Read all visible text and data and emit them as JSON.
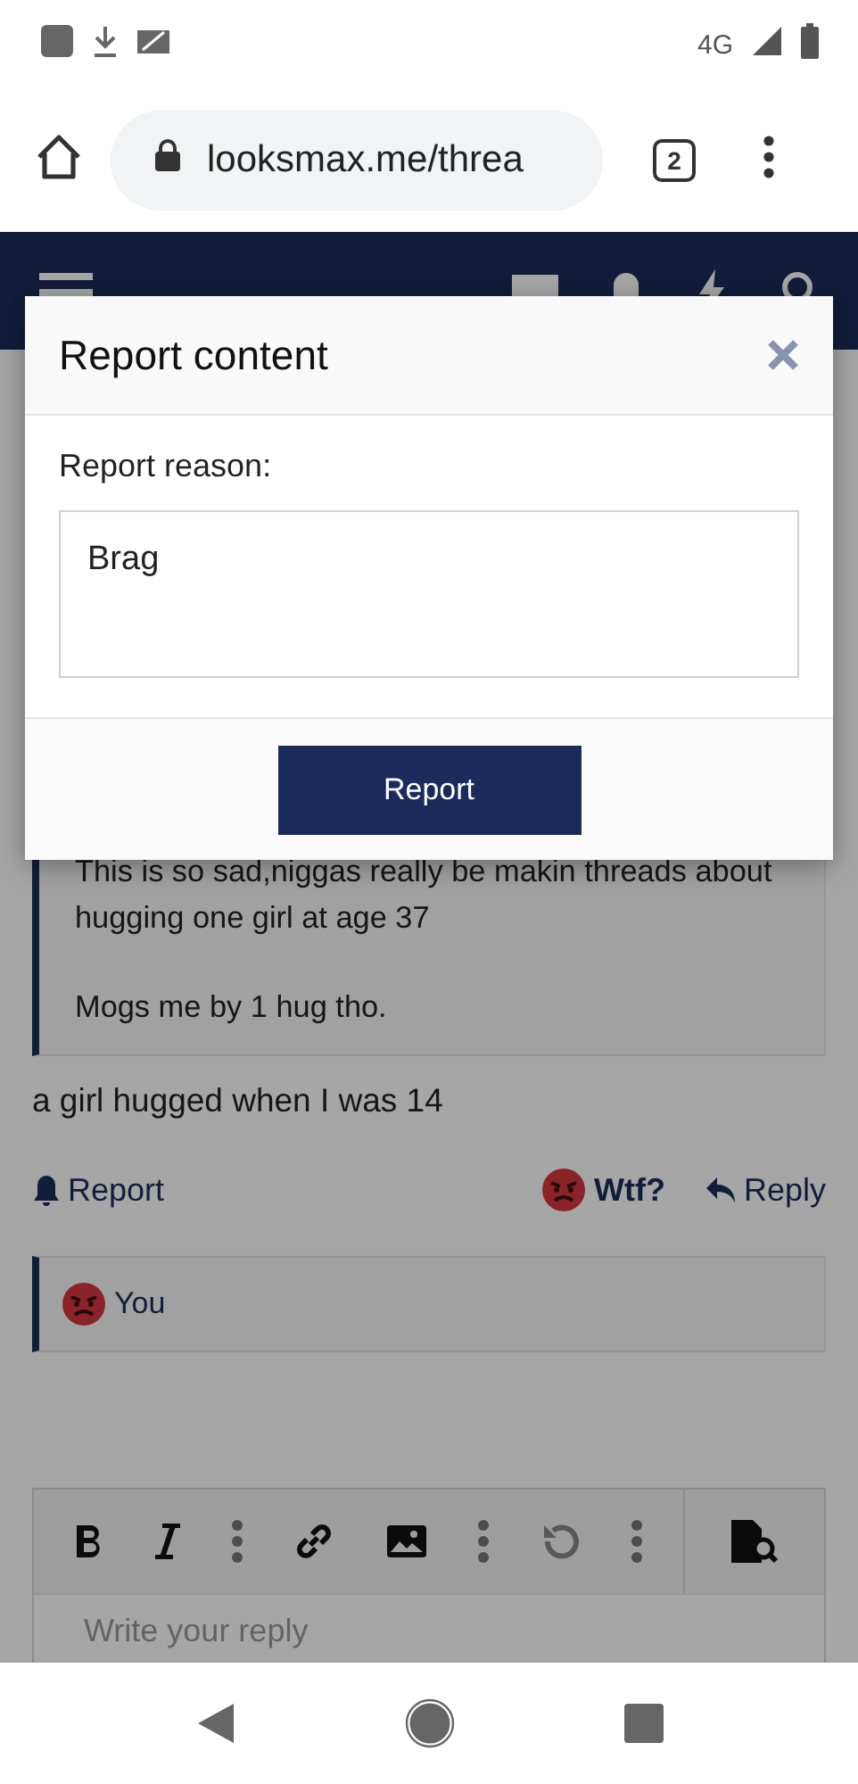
{
  "status_bar": {
    "network": "4G"
  },
  "browser": {
    "url": "looksmax.me/threa",
    "tab_count": "2"
  },
  "dialog": {
    "title": "Report content",
    "label": "Report reason:",
    "value": "Brag",
    "button": "Report"
  },
  "post": {
    "quote": [
      "This is so sad,niggas really be makin threads about hugging one girl at age 37",
      "Mogs me by 1 hug tho."
    ],
    "body": "a girl hugged when I was 14",
    "actions": [
      {
        "kind": "report",
        "label": "Report"
      },
      {
        "kind": "reaction",
        "label": "Wtf?"
      },
      {
        "kind": "reply",
        "label": "Reply"
      }
    ],
    "reactions": {
      "label": "You"
    }
  },
  "editor": {
    "placeholder": "Write your reply"
  }
}
